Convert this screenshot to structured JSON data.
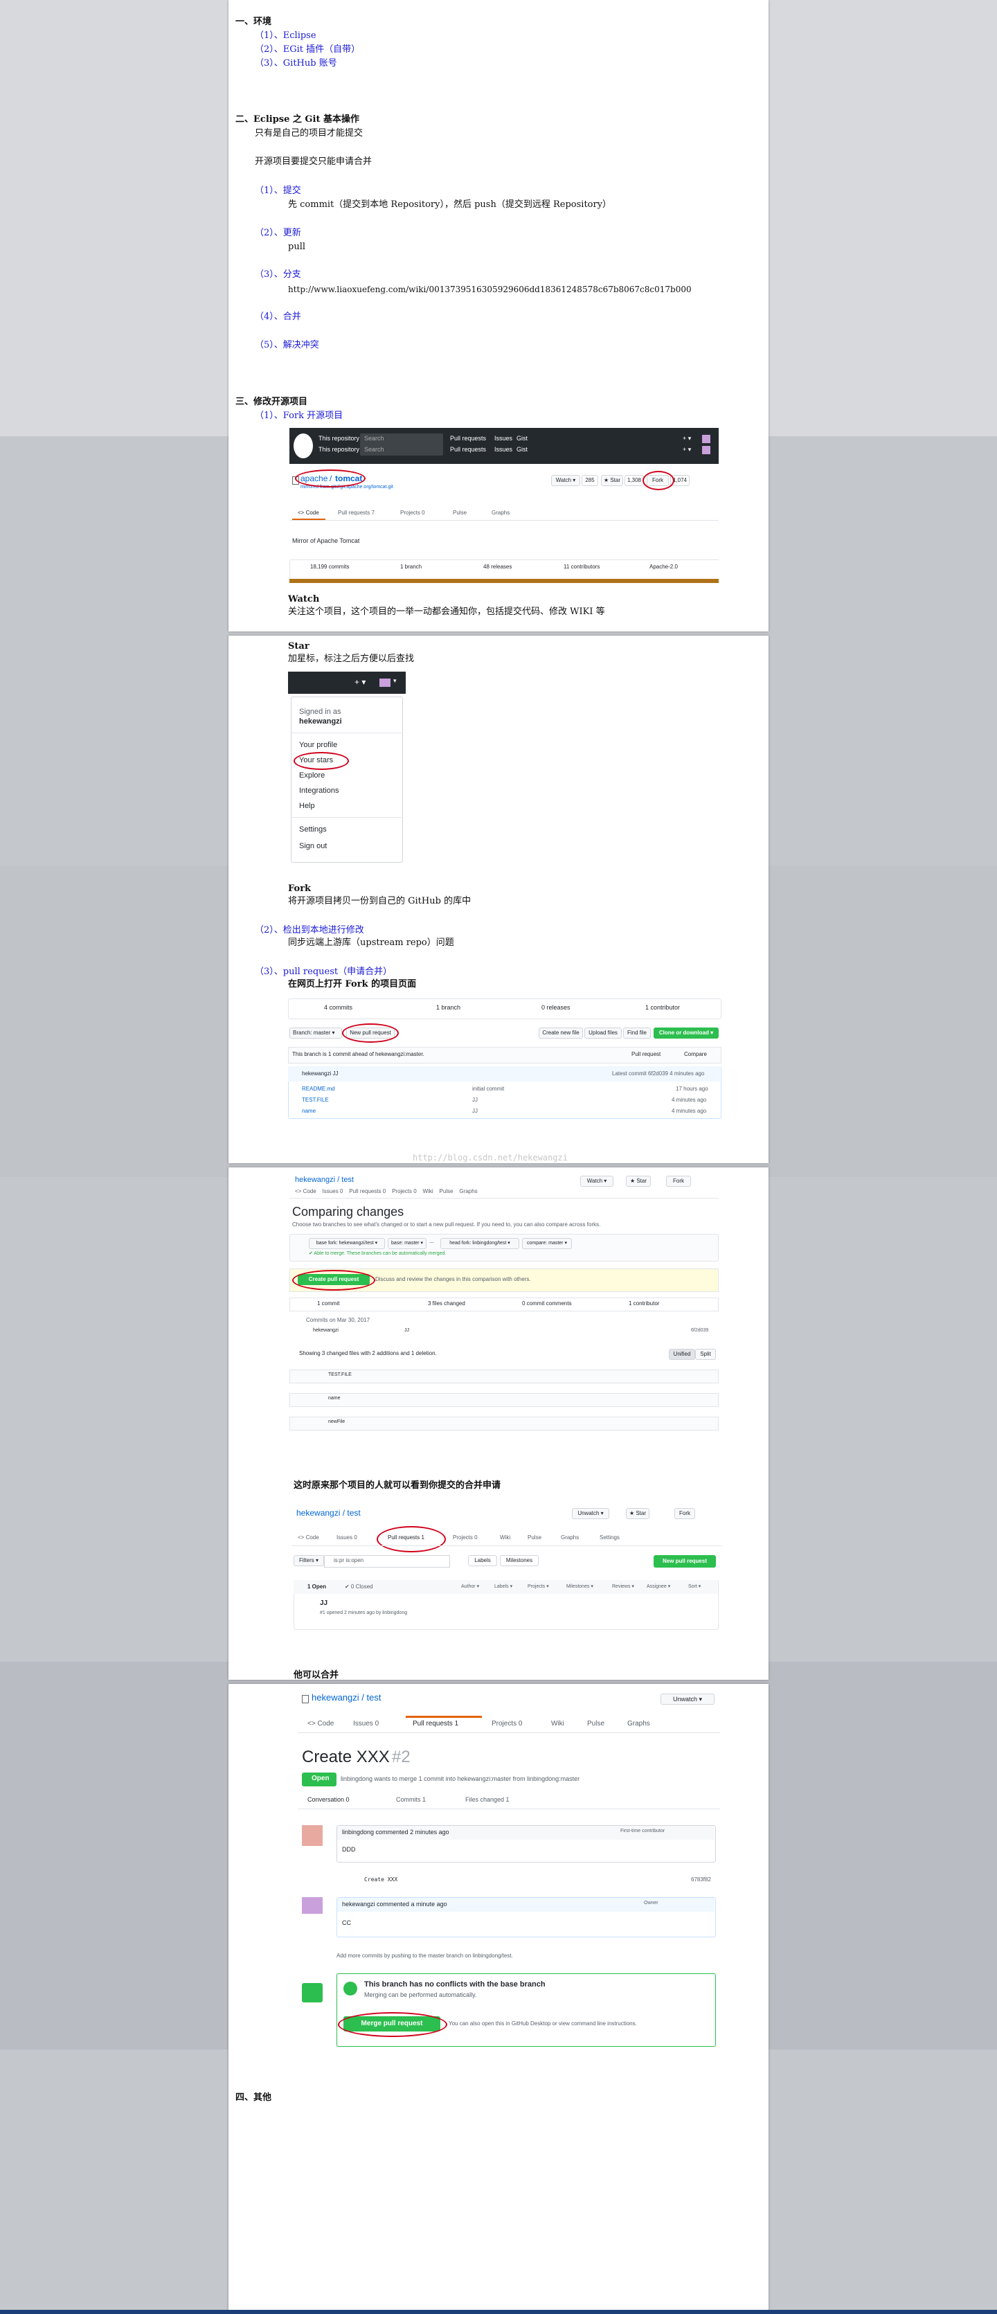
{
  "sections": {
    "s1": {
      "title": "一、环境",
      "items": [
        "（1）、Eclipse",
        "（2）、EGit 插件（自带）",
        "（3）、GitHub 账号"
      ]
    },
    "s2": {
      "title": "二、Eclipse 之 Git 基本操作",
      "line1": "只有是自己的项目才能提交",
      "line2": "开源项目要提交只能申请合并",
      "items": [
        {
          "title": "（1）、提交",
          "desc": "先 commit（提交到本地 Repository），然后 push（提交到远程 Repository）"
        },
        {
          "title": "（2）、更新",
          "desc": "pull"
        },
        {
          "title": "（3）、分支",
          "desc": "http://www.liaoxuefeng.com/wiki/0013739516305929606dd18361248578c67b8067c8c017b000"
        },
        {
          "title": "（4）、合并",
          "desc": ""
        },
        {
          "title": "（5）、解决冲突",
          "desc": ""
        }
      ]
    },
    "s3": {
      "title": "三、修改开源项目",
      "fork_title": "（1）、Fork 开源项目",
      "watch_title": "Watch",
      "watch_desc": "关注这个项目，这个项目的一举一动都会通知你，包括提交代码、修改 WIKI 等",
      "star_title": "Star",
      "star_desc": "加星标，标注之后方便以后查找",
      "fork2_title": "Fork",
      "fork2_desc": "将开源项目拷贝一份到自己的 GitHub 的库中",
      "checkout_title": "（2）、检出到本地进行修改",
      "checkout_desc": "同步远端上游库（upstream repo）问题",
      "pr_title": "（3）、pull request（申请合并）",
      "pr_desc": "在网页上打开 Fork 的项目页面",
      "owner_sees": "这时原来那个项目的人就可以看到你提交的合并申请",
      "can_merge": "他可以合并"
    },
    "s4": {
      "title": "四、其他"
    }
  },
  "shot_tomcat": {
    "this_repository": "This repository",
    "search": "Search",
    "nav": [
      "Pull requests",
      "Issues",
      "Gist"
    ],
    "repo_owner": "apache",
    "repo_name": "tomcat",
    "mirror_of": "mirrored from git://git.apache.org/tomcat.git",
    "watch": "Watch ▾",
    "watch_count": "285",
    "star": "★ Star",
    "star_count": "1,308",
    "fork": "Fork",
    "fork_count": "1,074",
    "tabs": [
      "<> Code",
      "Pull requests 7",
      "Projects 0",
      "Pulse",
      "Graphs"
    ],
    "desc": "Mirror of Apache Tomcat",
    "stats": [
      "18,199 commits",
      "1 branch",
      "48 releases",
      "11 contributors",
      "Apache-2.0"
    ]
  },
  "shot_menu": {
    "signed_in_as": "Signed in as",
    "user": "hekewangzi",
    "items": [
      "Your profile",
      "Your stars",
      "Explore",
      "Integrations",
      "Help",
      "Settings",
      "Sign out"
    ]
  },
  "shot_repo": {
    "stats": [
      "4 commits",
      "1 branch",
      "0 releases",
      "1 contributor"
    ],
    "branch": "Branch: master ▾",
    "new_pr": "New pull request",
    "actions": [
      "Create new file",
      "Upload files",
      "Find file",
      "Clone or download ▾"
    ],
    "ahead": "This branch is 1 commit ahead of hekewangzi:master.",
    "pull_request": "Pull request",
    "compare": "Compare",
    "latest_user": "hekewangzi JJ",
    "latest_commit": "Latest commit 6f2d039 4 minutes ago",
    "files": [
      {
        "name": "README.md",
        "msg": "initial commit",
        "age": "17 hours ago"
      },
      {
        "name": "TEST.FILE",
        "msg": "JJ",
        "age": "4 minutes ago"
      },
      {
        "name": "name",
        "msg": "JJ",
        "age": "4 minutes ago"
      }
    ],
    "watermark": "http://blog.csdn.net/hekewangzi"
  },
  "shot_compare": {
    "repo": "hekewangzi / test",
    "title": "Comparing changes",
    "subtitle": "Choose two branches to see what's changed or to start a new pull request. If you need to, you can also compare across forks.",
    "base_fork": "base fork: hekewangzi/test ▾",
    "base": "base: master ▾",
    "head_fork": "head fork: linbingdong/test ▾",
    "compare": "compare: master ▾",
    "able": "✔ Able to merge. These branches can be automatically merged.",
    "create_pr": "Create pull request",
    "discuss": "Discuss and review the changes in this comparison with others.",
    "stats": [
      "1 commit",
      "3 files changed",
      "0 commit comments",
      "1 contributor"
    ],
    "commits_on": "Commits on Mar 30, 2017",
    "commit_user": "hekewangzi",
    "commit_msg": "JJ",
    "commit_sha": "6f2d039",
    "showing": "Showing 3 changed files with 2 additions and 1 deletion.",
    "unified": "Unified",
    "split": "Split",
    "files": [
      "TEST.FILE",
      "name",
      "newFile"
    ]
  },
  "shot_prlist": {
    "repo": "hekewangzi / test",
    "unwatch": "Unwatch ▾",
    "star": "★ Star",
    "fork": "Fork",
    "tabs": [
      "<> Code",
      "Issues 0",
      "Pull requests 1",
      "Projects 0",
      "Wiki",
      "Pulse",
      "Graphs",
      "Settings"
    ],
    "filters": "Filters ▾",
    "query": "is:pr is:open",
    "labels": "Labels",
    "milestones": "Milestones",
    "new_pr": "New pull request",
    "open": "1 Open",
    "closed": "✔ 0 Closed",
    "cols": [
      "Author ▾",
      "Labels ▾",
      "Projects ▾",
      "Milestones ▾",
      "Reviews ▾",
      "Assignee ▾",
      "Sort ▾"
    ],
    "pr_title": "JJ",
    "pr_meta": "#1 opened 2 minutes ago by linbingdong"
  },
  "shot_pr": {
    "repo": "hekewangzi / test",
    "unwatch": "Unwatch ▾",
    "tabs": [
      "<> Code",
      "Issues 0",
      "Pull requests 1",
      "Projects 0",
      "Wiki",
      "Pulse",
      "Graphs"
    ],
    "title": "Create XXX",
    "number": "#2",
    "state": "Open",
    "merge_line": "linbingdong wants to merge 1 commit into hekewangzi:master from linbingdong:master",
    "subtabs": [
      "Conversation 0",
      "Commits 1",
      "Files changed 1"
    ],
    "c1_head": "linbingdong commented 2 minutes ago",
    "c1_badge": "First-time contributor",
    "c1_body": "DDD",
    "commit_msg": "Create XXX",
    "commit_sha": "6783f82",
    "c2_head": "hekewangzi commented a minute ago",
    "c2_badge": "Owner",
    "c2_body": "CC",
    "add_more": "Add more commits by pushing to the master branch on linbingdong/test.",
    "no_conflict": "This branch has no conflicts with the base branch",
    "auto_merge": "Merging can be performed automatically.",
    "merge_btn": "Merge pull request",
    "also": "You can also open this in GitHub Desktop or view command line instructions."
  }
}
